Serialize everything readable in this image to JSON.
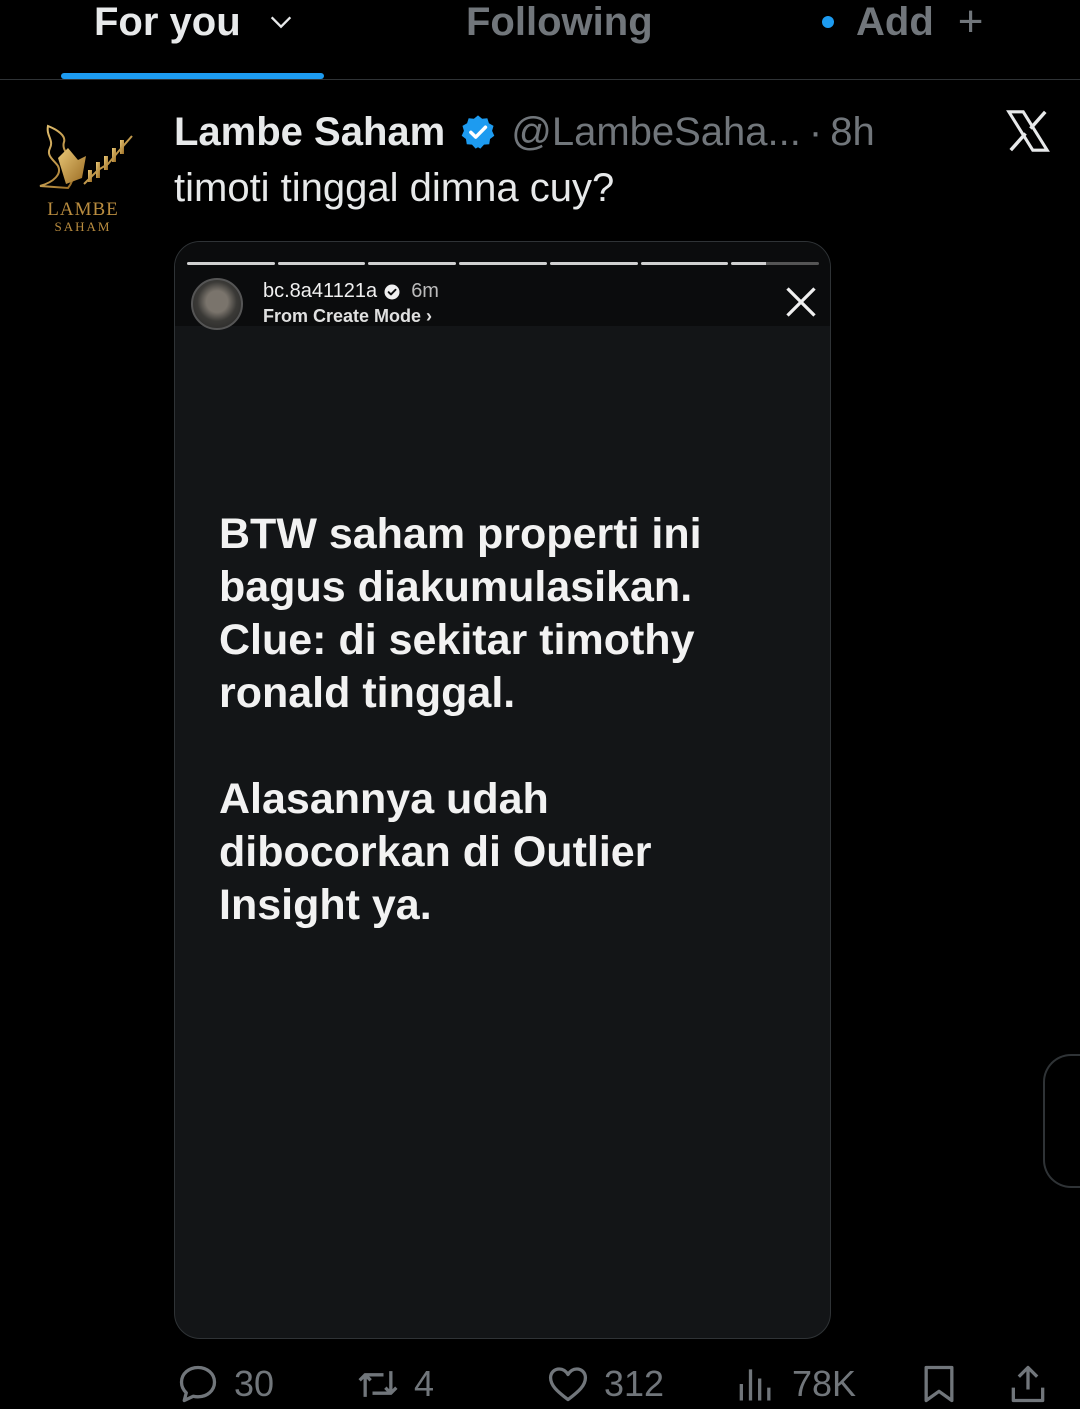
{
  "tabs": {
    "for_you": "For you",
    "following": "Following",
    "add": "Add",
    "add_plus": "+"
  },
  "post": {
    "avatar_text_line1": "LAMBE",
    "avatar_text_line2": "SAHAM",
    "author_name": "Lambe Saham",
    "handle": "@LambeSaha...",
    "separator": "·",
    "time": "8h",
    "text": "timoti tinggal dimna cuy?"
  },
  "story": {
    "username": "bc.8a41121a",
    "time": "6m",
    "subtitle": "From Create Mode ›",
    "body": "BTW saham properti ini\nbagus diakumulasikan.\nClue: di sekitar timothy\nronald tinggal.\n\nAlasannya udah\ndibocorkan di Outlier\nInsight ya."
  },
  "actions": {
    "replies": "30",
    "reposts": "4",
    "likes": "312",
    "views": "78K"
  },
  "colors": {
    "accent": "#1d9bf0",
    "muted": "#71767b",
    "text": "#e7e9ea",
    "gold": "#b98c3f"
  },
  "icons": [
    "chevron-down-icon",
    "verified-badge-icon",
    "x-logo-icon",
    "close-icon",
    "reply-icon",
    "repost-icon",
    "like-icon",
    "views-icon",
    "bookmark-icon",
    "share-icon"
  ]
}
